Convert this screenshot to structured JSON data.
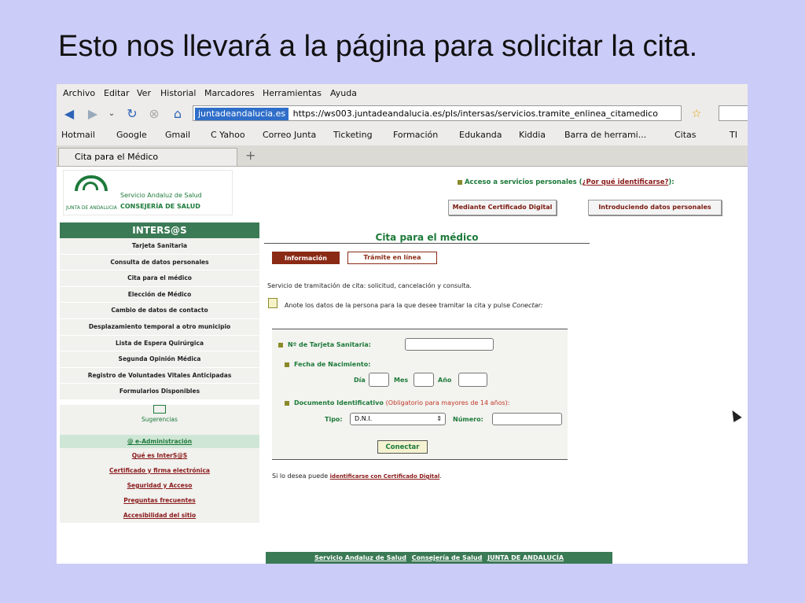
{
  "slide": {
    "title": "Esto nos llevará a la página para solicitar la cita."
  },
  "browser": {
    "menu": [
      "Archivo",
      "Editar",
      "Ver",
      "Historial",
      "Marcadores",
      "Herramientas",
      "Ayuda"
    ],
    "url_site": "juntadeandalucia.es",
    "url": "https://ws003.juntadeandalucia.es/pls/intersas/servicios.tramite_enlinea_citamedico",
    "bookmarks": [
      "Hotmail",
      "Google",
      "Gmail",
      "C Yahoo",
      "Correo Junta",
      "Ticketing",
      "Formación",
      "Edukanda",
      "Kiddia",
      "Barra de herrami...",
      "Citas",
      "TI"
    ],
    "tab_title": "Cita para el Médico",
    "new_tab": "+"
  },
  "header": {
    "logo_org": "Servicio Andaluz de Salud",
    "logo_dept": "CONSEJERÍA DE SALUD",
    "logo_junta": "JUNTA DE ANDALUCIA",
    "access_label": "Acceso a servicios personales",
    "access_why": "¿Por qué identificarse?",
    "btn_cert": "Mediante Certificado Digital",
    "btn_data": "Introduciendo datos personales"
  },
  "sidebar": {
    "title": "INTERS@S",
    "items": [
      "Tarjeta Sanitaria",
      "Consulta de datos personales",
      "Cita para el médico",
      "Elección de Médico",
      "Cambio de datos de contacto",
      "Desplazamiento temporal a otro municipio",
      "Lista de Espera Quirúrgica",
      "Segunda Opinión Médica",
      "Registro de Voluntades Vitales Anticipadas",
      "Formularios Disponibles"
    ],
    "suggestions": "Sugerencias",
    "eadmin": "@  e-Administración",
    "links": [
      "Qué es InterS@S",
      "Certificado y firma electrónica",
      "Seguridad y Acceso",
      "Preguntas frecuentes",
      "Accesibilidad del sitio"
    ]
  },
  "content": {
    "title": "Cita para el médico",
    "tab_info": "Información",
    "tab_tramite": "Trámite en línea",
    "description": "Servicio de tramitación de cita: solicitud, cancelación y consulta.",
    "note": "Anote los datos de la persona para la que desee tramitar la cita y pulse",
    "note_action": "Conectar:",
    "form": {
      "card_label": "Nº de Tarjeta Sanitaria:",
      "birth_label": "Fecha de Nacimiento:",
      "day_label": "Día",
      "month_label": "Mes",
      "year_label": "Año",
      "doc_label": "Documento Identificativo",
      "doc_optional": "(Obligatorio para mayores de 14 años):",
      "type_label": "Tipo:",
      "type_value": "D.N.I.",
      "number_label": "Número:",
      "submit": "Conectar"
    },
    "cert_text": "Si lo desea puede",
    "cert_link": "identificarse con Certificado Digital",
    "cert_end": "."
  },
  "footer": {
    "links": [
      "Servicio Andaluz de Salud",
      "Consejería de Salud",
      "JUNTA DE ANDALUCÍA"
    ]
  }
}
